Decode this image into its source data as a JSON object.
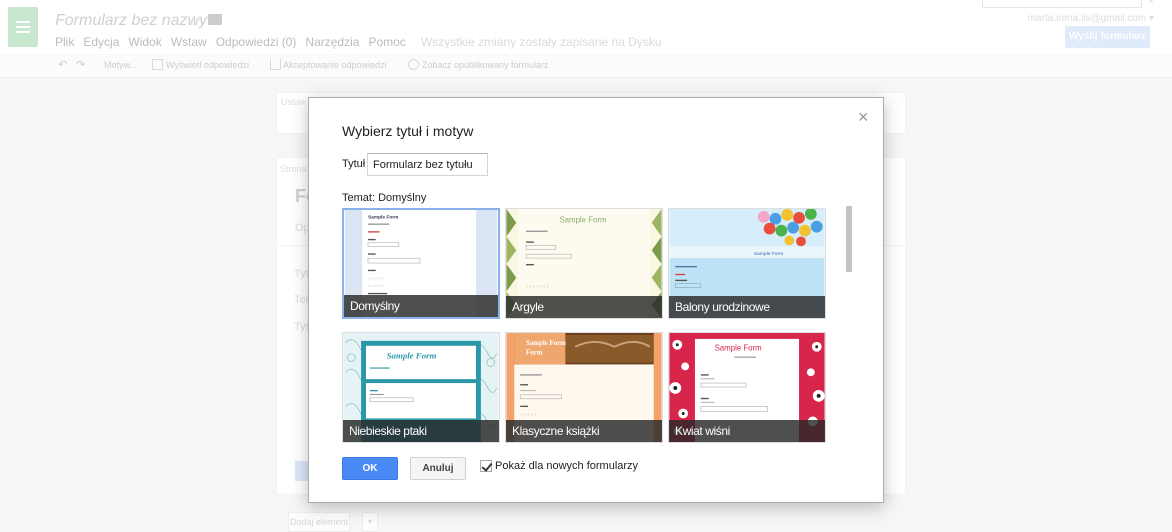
{
  "app": {
    "doc_title": "Formularz bez nazwy",
    "user_email": "marta.irena.lis@gmail.com ▾",
    "send_button": "Wyślij formularz",
    "menu": [
      "Plik",
      "Edycja",
      "Widok",
      "Wstaw",
      "Odpowiedzi (0)",
      "Narzędzia",
      "Pomoc"
    ],
    "save_status": "Wszystkie zmiany zostały zapisane na Dysku",
    "toolbar": {
      "theme": "Motyw...",
      "view_responses": "Wyświetl odpowiedzi",
      "accepting_responses": "Akceptowanie odpowiedzi",
      "view_published": "Zobacz opublikowany formularz"
    },
    "background": {
      "settings": "Ustaw",
      "page": "Strona",
      "form_title": "Fo",
      "description": "Op",
      "question_title": "Tyt",
      "help_text": "Tek",
      "question_type": "Tyt",
      "add_item": "Dodaj element",
      "add_item_caret": "▾"
    }
  },
  "dialog": {
    "title": "Wybierz tytuł i motyw",
    "close": "×",
    "title_label": "Tytuł",
    "title_value": "Formularz bez tytułu",
    "theme_label": "Temat: Domyślny",
    "themes": [
      {
        "name": "Domyślny",
        "selected": true,
        "thumb_text": "Sample Form"
      },
      {
        "name": "Argyle",
        "selected": false,
        "thumb_text": "Sample Form"
      },
      {
        "name": "Balony urodzinowe",
        "selected": false,
        "thumb_text": "Sample Form"
      },
      {
        "name": "Niebieskie ptaki",
        "selected": false,
        "thumb_text": "Sample Form"
      },
      {
        "name": "Klasyczne książki",
        "selected": false,
        "thumb_text": "Sample Form"
      },
      {
        "name": "Kwiat wiśni",
        "selected": false,
        "thumb_text": "Sample Form"
      }
    ],
    "ok": "OK",
    "cancel": "Anuluj",
    "show_for_new": "Pokaż dla nowych formularzy",
    "show_for_new_checked": true
  },
  "colors": {
    "accent": "#4a8af4",
    "logo": "#8fd19f",
    "selected_border": "#8bb2e8"
  }
}
